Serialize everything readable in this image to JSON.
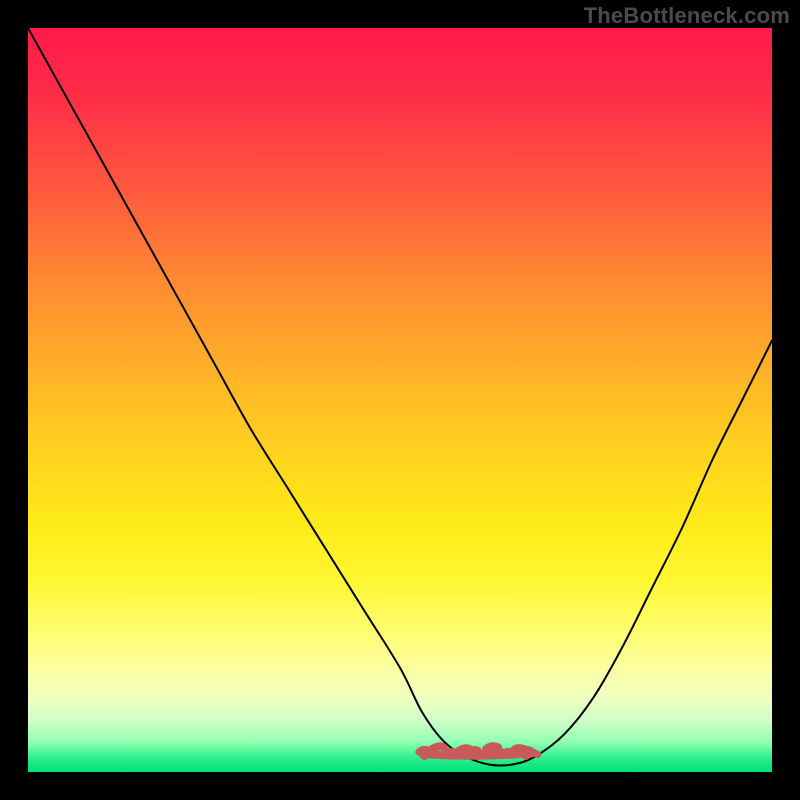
{
  "watermark": {
    "text": "TheBottleneck.com"
  },
  "colors": {
    "frame": "#000000",
    "gradient_top": "#ff1a4a",
    "gradient_bottom": "#00e078",
    "curve": "#000000",
    "valley_accent": "#c85a5a"
  },
  "chart_data": {
    "type": "line",
    "title": "",
    "xlabel": "",
    "ylabel": "",
    "xlim": [
      0,
      100
    ],
    "ylim": [
      0,
      100
    ],
    "grid": false,
    "legend": false,
    "background_gradient": "red-orange-yellow-green (top to bottom)",
    "series": [
      {
        "name": "curve",
        "x": [
          0,
          5,
          10,
          15,
          20,
          25,
          30,
          35,
          40,
          45,
          50,
          53,
          56,
          59,
          62,
          65,
          68,
          72,
          76,
          80,
          84,
          88,
          92,
          96,
          100
        ],
        "y": [
          100,
          91,
          82,
          73,
          64,
          55,
          46,
          38,
          30,
          22,
          14,
          8,
          4,
          2,
          1,
          1,
          2,
          5,
          10,
          17,
          25,
          33,
          42,
          50,
          58
        ]
      }
    ],
    "annotation": {
      "valley_highlight": {
        "x_range": [
          53,
          68
        ],
        "style": "thick-rough-line",
        "color": "#c85a5a"
      }
    }
  }
}
